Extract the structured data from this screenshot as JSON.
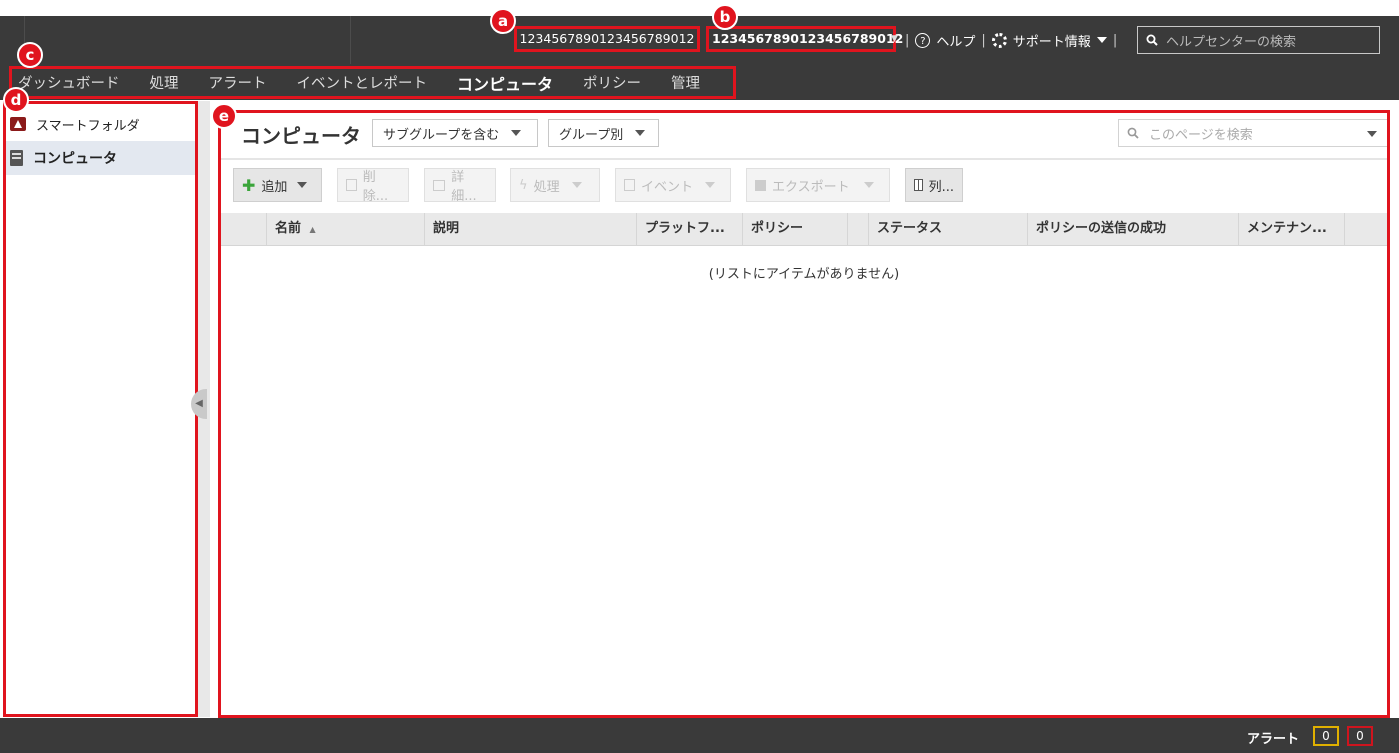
{
  "markers": {
    "a": "a",
    "b": "b",
    "c": "c",
    "d": "d",
    "e": "e"
  },
  "topbar": {
    "account_id": "1234567890123456789012",
    "user_id": "1234567890123456789012",
    "help_label": "ヘルプ",
    "support_label": "サポート情報",
    "search_placeholder": "ヘルプセンターの検索",
    "pipe": "|"
  },
  "nav": {
    "items": [
      {
        "label": "ダッシュボード",
        "active": false
      },
      {
        "label": "処理",
        "active": false
      },
      {
        "label": "アラート",
        "active": false
      },
      {
        "label": "イベントとレポート",
        "active": false
      },
      {
        "label": "コンピュータ",
        "active": true
      },
      {
        "label": "ポリシー",
        "active": false
      },
      {
        "label": "管理",
        "active": false
      }
    ]
  },
  "sidebar": {
    "items": [
      {
        "label": "スマートフォルダ",
        "icon": "smart-folder-icon"
      },
      {
        "label": "コンピュータ",
        "icon": "computer-icon",
        "active": true
      }
    ]
  },
  "main": {
    "title": "コンピュータ",
    "subgroup_dropdown": "サブグループを含む",
    "group_dropdown": "グループ別",
    "search_placeholder": "このページを検索",
    "toolbar": {
      "add": "追加",
      "delete": "削除...",
      "details": "詳細...",
      "actions": "処理",
      "events": "イベント",
      "export": "エクスポート",
      "columns": "列..."
    },
    "columns": [
      "名前",
      "説明",
      "プラットフ...",
      "ポリシー",
      "ステータス",
      "ポリシーの送信の成功",
      "メンテナン..."
    ],
    "sort_indicator": "▲",
    "empty_message": "(リストにアイテムがありません)"
  },
  "footer": {
    "alerts_label": "アラート",
    "count_warning": "0",
    "count_critical": "0",
    "colors": {
      "warning": "#e0b000",
      "critical": "#d0141e"
    }
  }
}
